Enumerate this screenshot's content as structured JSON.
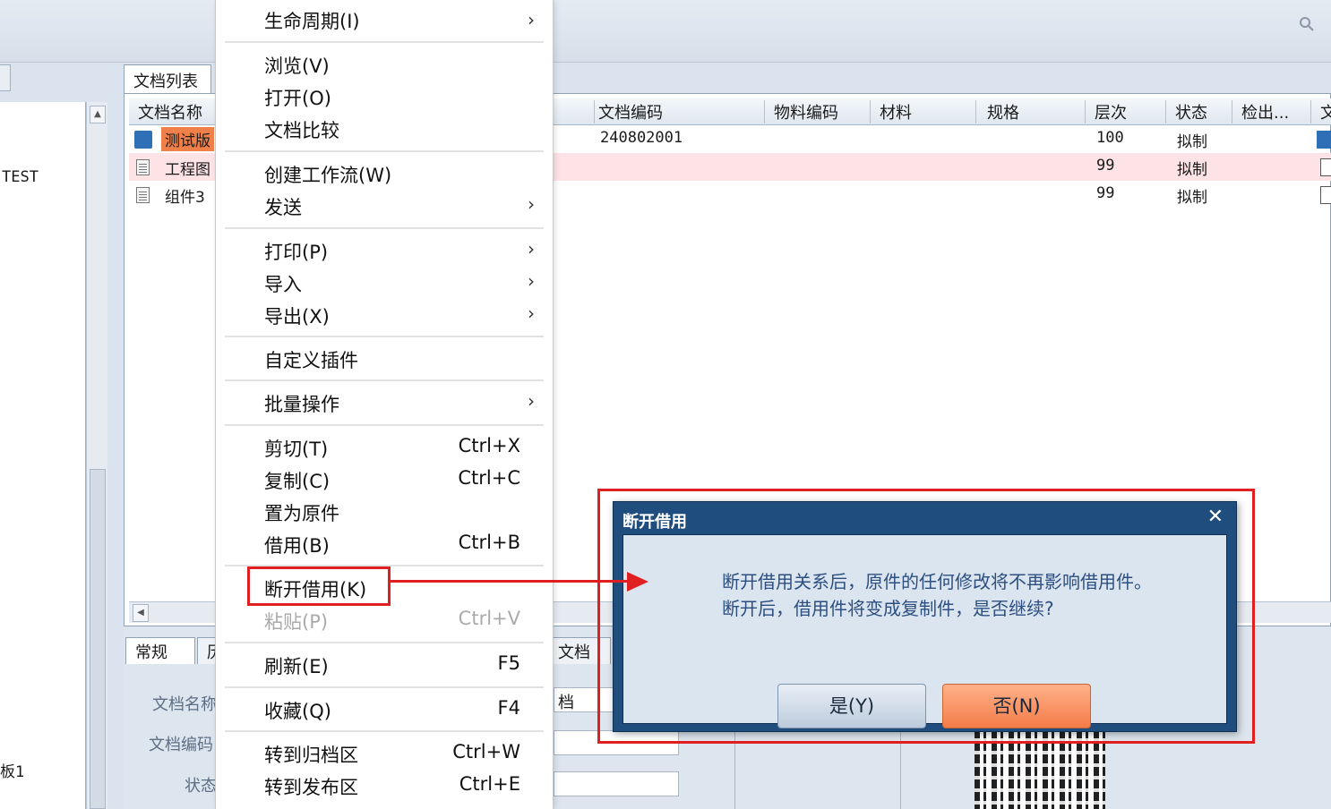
{
  "left": {
    "text1": "TEST",
    "text2": "板1"
  },
  "doclist": {
    "tab": "文档列表",
    "columns": [
      "文档名称",
      "文档编码",
      "物料编码",
      "材料",
      "规格",
      "层次",
      "状态",
      "检出...",
      "文"
    ],
    "rows": [
      {
        "name": "测试版",
        "code": "240802001",
        "level": "100",
        "status": "拟制"
      },
      {
        "name": "工程图",
        "code": "",
        "level": "99",
        "status": "拟制"
      },
      {
        "name": "组件3",
        "code": "",
        "level": "99",
        "status": "拟制"
      }
    ]
  },
  "bottom": {
    "tabs": [
      "常规",
      "历",
      "文档"
    ],
    "labels": [
      "文档名称",
      "文档编码",
      "状态"
    ],
    "field_value": "档"
  },
  "menu": {
    "items": [
      {
        "label": "生命周期(I)",
        "shortcut": "",
        "submenu": true
      },
      {
        "label": "浏览(V)",
        "shortcut": "",
        "submenu": false
      },
      {
        "label": "打开(O)",
        "shortcut": "",
        "submenu": false
      },
      {
        "label": "文档比较",
        "shortcut": "",
        "submenu": false
      },
      {
        "label": "创建工作流(W)",
        "shortcut": "",
        "submenu": false
      },
      {
        "label": "发送",
        "shortcut": "",
        "submenu": true
      },
      {
        "label": "打印(P)",
        "shortcut": "",
        "submenu": true
      },
      {
        "label": "导入",
        "shortcut": "",
        "submenu": true
      },
      {
        "label": "导出(X)",
        "shortcut": "",
        "submenu": true
      },
      {
        "label": "自定义插件",
        "shortcut": "",
        "submenu": false
      },
      {
        "label": "批量操作",
        "shortcut": "",
        "submenu": true
      },
      {
        "label": "剪切(T)",
        "shortcut": "Ctrl+X",
        "submenu": false
      },
      {
        "label": "复制(C)",
        "shortcut": "Ctrl+C",
        "submenu": false
      },
      {
        "label": "置为原件",
        "shortcut": "",
        "submenu": false
      },
      {
        "label": "借用(B)",
        "shortcut": "Ctrl+B",
        "submenu": false
      },
      {
        "label": "断开借用(K)",
        "shortcut": "",
        "submenu": false
      },
      {
        "label": "粘贴(P)",
        "shortcut": "Ctrl+V",
        "submenu": false,
        "disabled": true
      },
      {
        "label": "刷新(E)",
        "shortcut": "F5",
        "submenu": false
      },
      {
        "label": "收藏(Q)",
        "shortcut": "F4",
        "submenu": false
      },
      {
        "label": "转到归档区",
        "shortcut": "Ctrl+W",
        "submenu": false
      },
      {
        "label": "转到发布区",
        "shortcut": "Ctrl+E",
        "submenu": false
      }
    ]
  },
  "dialog": {
    "title": "断开借用",
    "close": "✕",
    "message_line1": "断开借用关系后，原件的任何修改将不再影响借用件。",
    "message_line2": "断开后，借用件将变成复制件，是否继续?",
    "yes_label": "是(Y)",
    "no_label": "否(N)"
  },
  "colors": {
    "highlight": "#e02020",
    "dialog_title_bg": "#1f4d7d",
    "no_button": "#f47c48",
    "selected_row": "#fde3e6",
    "selected_cell": "#f0804a"
  }
}
